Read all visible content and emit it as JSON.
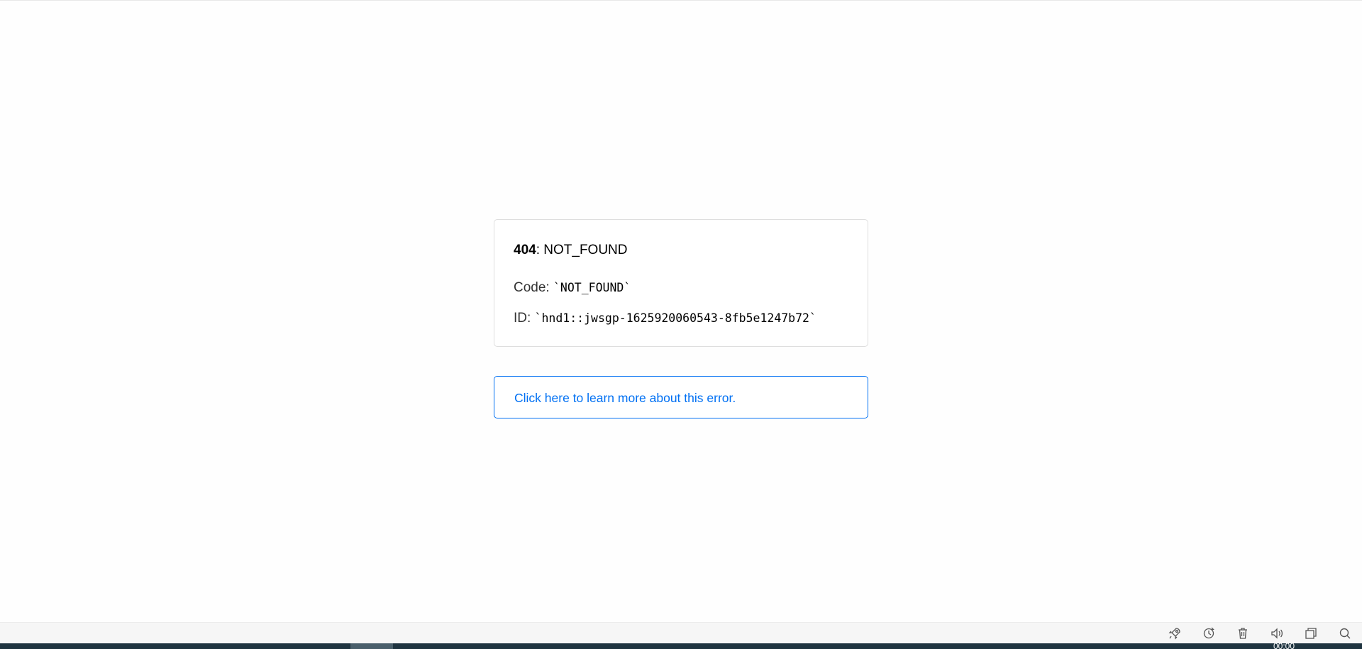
{
  "error": {
    "status_code": "404",
    "status_separator": ": ",
    "status_text": "NOT_FOUND",
    "code_label": "Code: ",
    "code_value": "`NOT_FOUND`",
    "id_label": "ID: ",
    "id_value": "`hnd1::jwsgp-1625920060543-8fb5e1247b72`"
  },
  "learn_more": {
    "text": "Click here to learn more about this error."
  },
  "taskbar": {
    "icons": [
      "rocket-icon",
      "refresh-icon",
      "trash-icon",
      "speaker-icon",
      "window-icon",
      "search-icon"
    ],
    "clock": "00:00"
  },
  "colors": {
    "link": "#0070f3",
    "card_border": "#dedede",
    "taskbar_dark": "#1f3440"
  }
}
